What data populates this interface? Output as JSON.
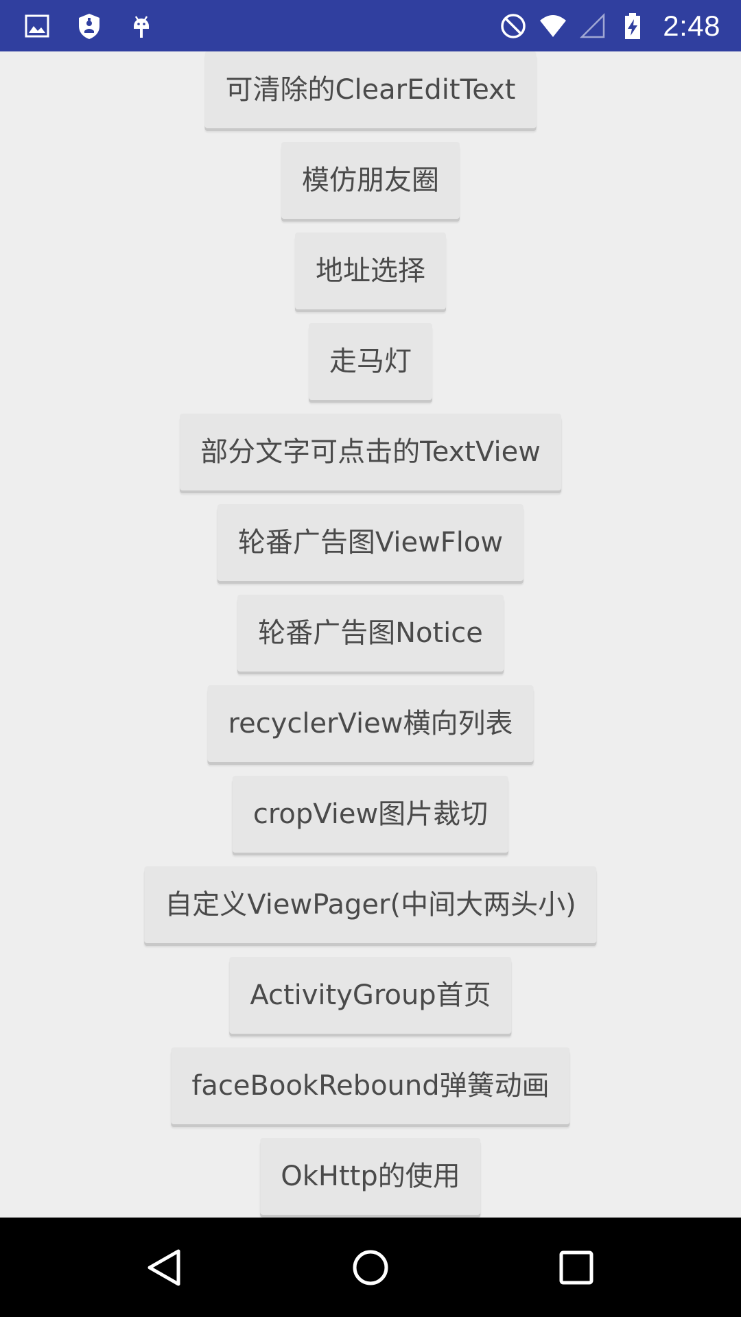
{
  "status_bar": {
    "time": "2:48",
    "left_icons": [
      "gallery-icon",
      "security-shield-icon",
      "android-debug-icon"
    ],
    "right_icons": [
      "do-not-disturb-icon",
      "wifi-icon",
      "cellular-signal-icon",
      "battery-charging-icon"
    ],
    "background_color": "#303f9f"
  },
  "buttons": [
    {
      "id": "clear-edit-text",
      "label": "可清除的ClearEditText"
    },
    {
      "id": "moments",
      "label": "模仿朋友圈"
    },
    {
      "id": "address-select",
      "label": "地址选择"
    },
    {
      "id": "marquee",
      "label": "走马灯"
    },
    {
      "id": "clickable-textview",
      "label": "部分文字可点击的TextView"
    },
    {
      "id": "viewflow-banner",
      "label": "轮番广告图ViewFlow"
    },
    {
      "id": "notice-banner",
      "label": "轮番广告图Notice"
    },
    {
      "id": "recyclerview-horizontal",
      "label": "recyclerView横向列表"
    },
    {
      "id": "cropview",
      "label": "cropView图片裁切"
    },
    {
      "id": "custom-viewpager",
      "label": "自定义ViewPager(中间大两头小)"
    },
    {
      "id": "activitygroup-home",
      "label": "ActivityGroup首页"
    },
    {
      "id": "facebook-rebound",
      "label": "faceBookRebound弹簧动画"
    },
    {
      "id": "okhttp-usage",
      "label": "OkHttp的使用"
    }
  ],
  "navigation_bar": {
    "items": [
      "back-icon",
      "home-icon",
      "recents-icon"
    ]
  },
  "colors": {
    "content_background": "#eeeeee",
    "button_background": "#e6e6e6",
    "button_text": "#4a4a4a",
    "nav_background": "#000000"
  }
}
